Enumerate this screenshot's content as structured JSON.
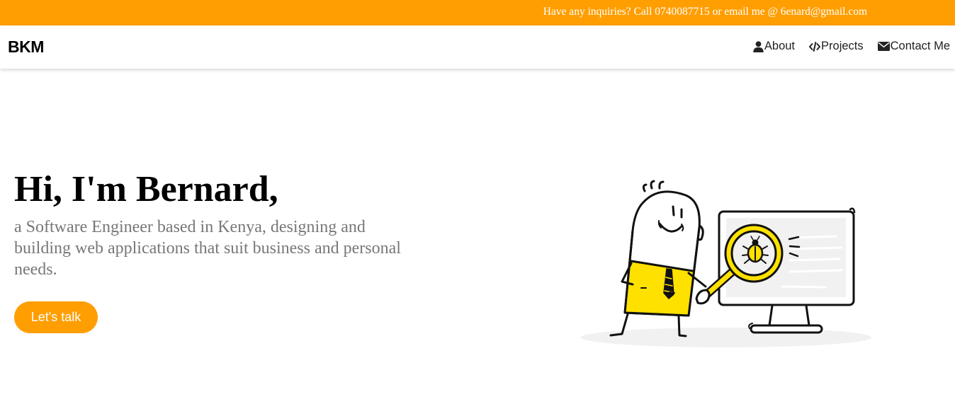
{
  "topbar": {
    "inquiry_text": "Have any inquiries? Call 0740087715 or email me @ 6enard@gmail.com"
  },
  "navbar": {
    "brand": "BKM",
    "links": [
      {
        "label": "About",
        "icon": "user-icon"
      },
      {
        "label": "Projects",
        "icon": "code-icon"
      },
      {
        "label": "Contact Me",
        "icon": "envelope-icon"
      }
    ]
  },
  "hero": {
    "title": "Hi, I'm Bernard,",
    "subtitle": "a Software Engineer based in Kenya, designing and building web applications that suit business and personal needs.",
    "cta_label": "Let's talk",
    "illustration": "developer-debugging-illustration"
  },
  "colors": {
    "accent": "#ff9e00",
    "illustration_yellow": "#ffe100",
    "subtitle_gray": "#777777"
  }
}
